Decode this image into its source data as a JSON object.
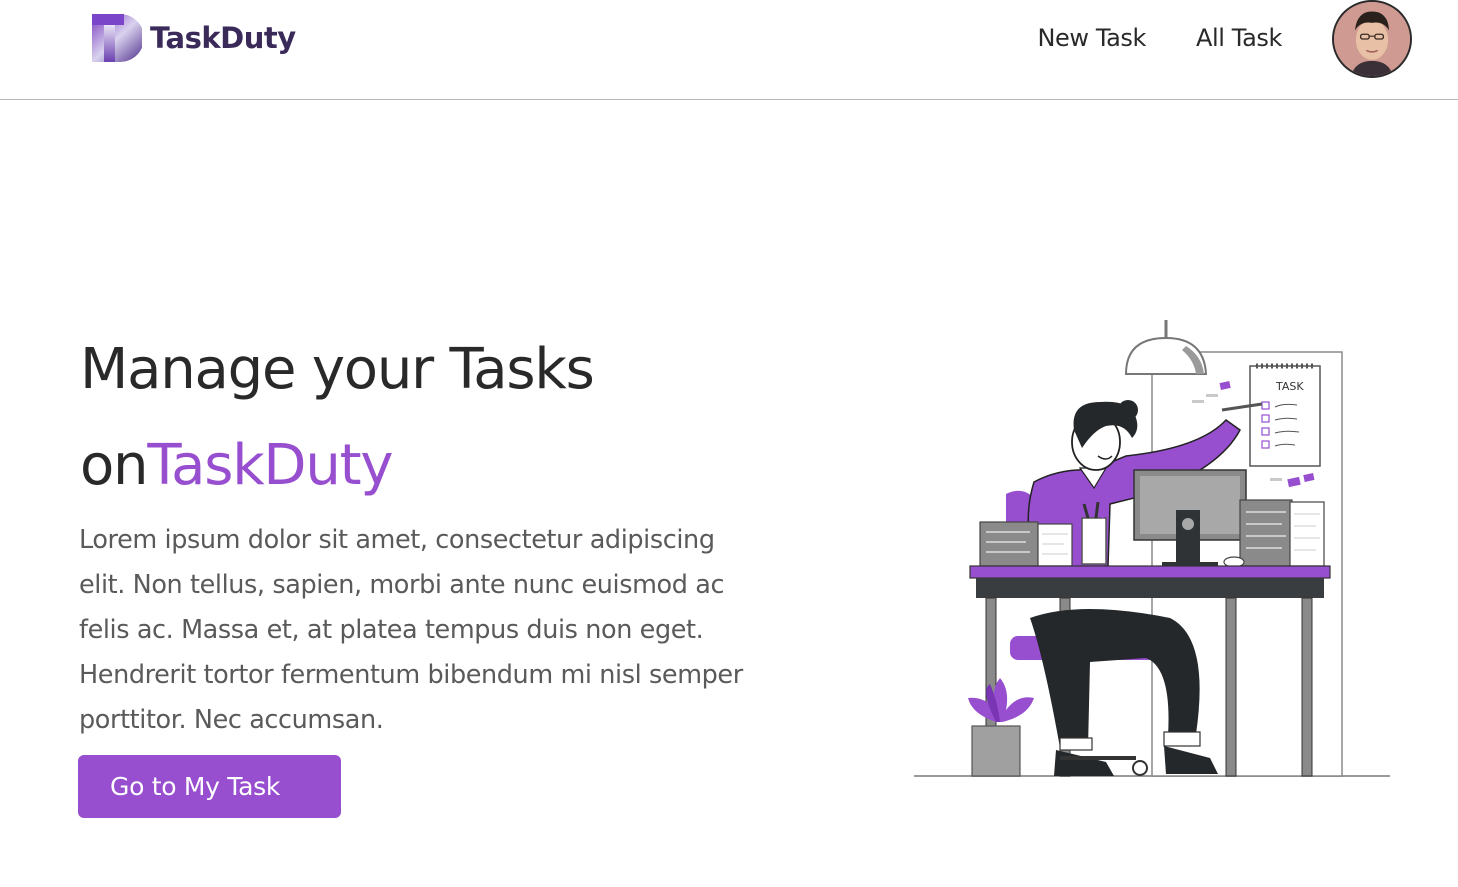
{
  "brand": {
    "name": "TaskDuty",
    "logo_icon": "taskduty-t-logo-icon"
  },
  "nav": {
    "links": [
      {
        "label": "New Task"
      },
      {
        "label": "All Task"
      }
    ]
  },
  "user": {
    "avatar_icon": "user-avatar"
  },
  "hero": {
    "title_line1": "Manage your Tasks",
    "title_prefix": "on",
    "title_accent": "TaskDuty",
    "description": "Lorem ipsum dolor sit amet, consectetur adipiscing elit. Non tellus, sapien, morbi ante nunc euismod ac felis ac. Massa et, at platea tempus duis non eget. Hendrerit tortor fermentum bibendum mi nisl semper porttitor. Nec accumsan.",
    "cta_label": "Go to My Task",
    "illustration_icon": "person-at-desk-illustration",
    "task_sheet_heading": "TASK"
  },
  "colors": {
    "accent": "#974fd0",
    "text": "#292929",
    "muted": "#5a5a5a",
    "border": "#b8b8b8"
  }
}
